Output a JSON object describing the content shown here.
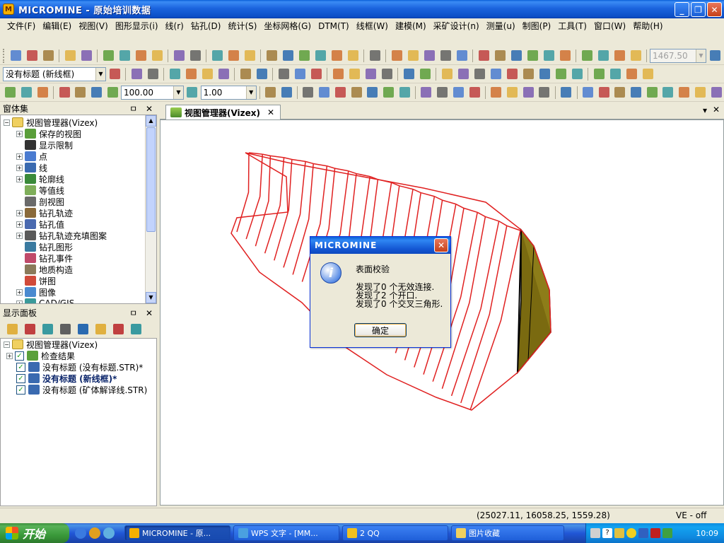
{
  "window": {
    "title": "MICROMINE - 原始培训数据",
    "controls": [
      "_",
      "❐",
      "✕"
    ]
  },
  "menu": [
    "文件(F)",
    "编辑(E)",
    "视图(V)",
    "图形显示(i)",
    "线(r)",
    "钻孔(D)",
    "统计(S)",
    "坐标网格(G)",
    "DTM(T)",
    "线框(W)",
    "建模(M)",
    "采矿设计(n)",
    "测量(u)",
    "制图(P)",
    "工具(T)",
    "窗口(W)",
    "帮助(H)"
  ],
  "toolbar": {
    "elevation_combo": "1467.50",
    "title_combo": "没有标题 (新线框)",
    "scale_value": "100.00",
    "ratio_value": "1.00"
  },
  "window_panel": {
    "header": "窗体集",
    "pin": "ㅁ",
    "close": "✕",
    "root": "视图管理器(Vizex)",
    "items": [
      {
        "label": "保存的视图",
        "color": "#5a9e3a",
        "expand": "+"
      },
      {
        "label": "显示限制",
        "color": "#333333",
        "expand": ""
      },
      {
        "label": "点",
        "color": "#4a7bd0",
        "expand": "+"
      },
      {
        "label": "线",
        "color": "#3a6ab0",
        "expand": "+"
      },
      {
        "label": "轮廓线",
        "color": "#3a8a3a",
        "expand": "+"
      },
      {
        "label": "等值线",
        "color": "#7fae5a",
        "expand": ""
      },
      {
        "label": "剖视图",
        "color": "#6a6a6a",
        "expand": ""
      },
      {
        "label": "钻孔轨迹",
        "color": "#8a6a3a",
        "expand": "+"
      },
      {
        "label": "钻孔值",
        "color": "#4a6ab0",
        "expand": "+"
      },
      {
        "label": "钻孔轨迹充填图案",
        "color": "#5a5a5a",
        "expand": "+"
      },
      {
        "label": "钻孔图形",
        "color": "#3a7aa0",
        "expand": ""
      },
      {
        "label": "钻孔事件",
        "color": "#c04a6a",
        "expand": ""
      },
      {
        "label": "地质构造",
        "color": "#8a7a5a",
        "expand": ""
      },
      {
        "label": "饼图",
        "color": "#d04a3a",
        "expand": ""
      },
      {
        "label": "图像",
        "color": "#4a8ad0",
        "expand": "+"
      },
      {
        "label": "CAD/GIS",
        "color": "#3a9a9a",
        "expand": "+"
      }
    ]
  },
  "display_panel": {
    "header": "显示面板",
    "pin": "ㅁ",
    "close": "✕",
    "root": "视图管理器(Vizex)",
    "layers": [
      {
        "label": "检查结果",
        "bold": false,
        "checked": true
      },
      {
        "label": "没有标题 (没有标题.STR)*",
        "bold": false,
        "checked": true
      },
      {
        "label": "没有标题 (新线框)*",
        "bold": true,
        "checked": true
      },
      {
        "label": "没有标题 (矿体解译线.STR)",
        "bold": false,
        "checked": true
      }
    ]
  },
  "document": {
    "tab_label": "视图管理器(Vizex)",
    "tab_close": "✕",
    "menu_arrow": "▾",
    "close": "✕"
  },
  "dialog": {
    "title": "MICROMINE",
    "close": "✕",
    "heading": "表面校验",
    "lines": [
      "发现了0 个无效连接.",
      "发现了2 个开口.",
      "发现了0 个交叉三角形."
    ],
    "ok_label": "确定",
    "icon": "info-icon"
  },
  "status": {
    "coordinates": "(25027.11, 16058.25, 1559.28)",
    "ve": "VE - off"
  },
  "taskbar": {
    "start_label": "开始",
    "tasks": [
      {
        "label": "MICROMINE - 原...",
        "active": true,
        "color": "#f5b000"
      },
      {
        "label": "WPS 文字 - [MM...",
        "active": false,
        "color": "#4aa0e0"
      },
      {
        "label": "2 QQ",
        "active": false,
        "color": "#f0c020"
      },
      {
        "label": "图片收藏",
        "active": false,
        "color": "#f0d060"
      }
    ],
    "clock": "10:09"
  },
  "colors": {
    "section_red": "#e02020",
    "fill_olive": "#7a6a10",
    "selection_blue": "#0a246a"
  }
}
